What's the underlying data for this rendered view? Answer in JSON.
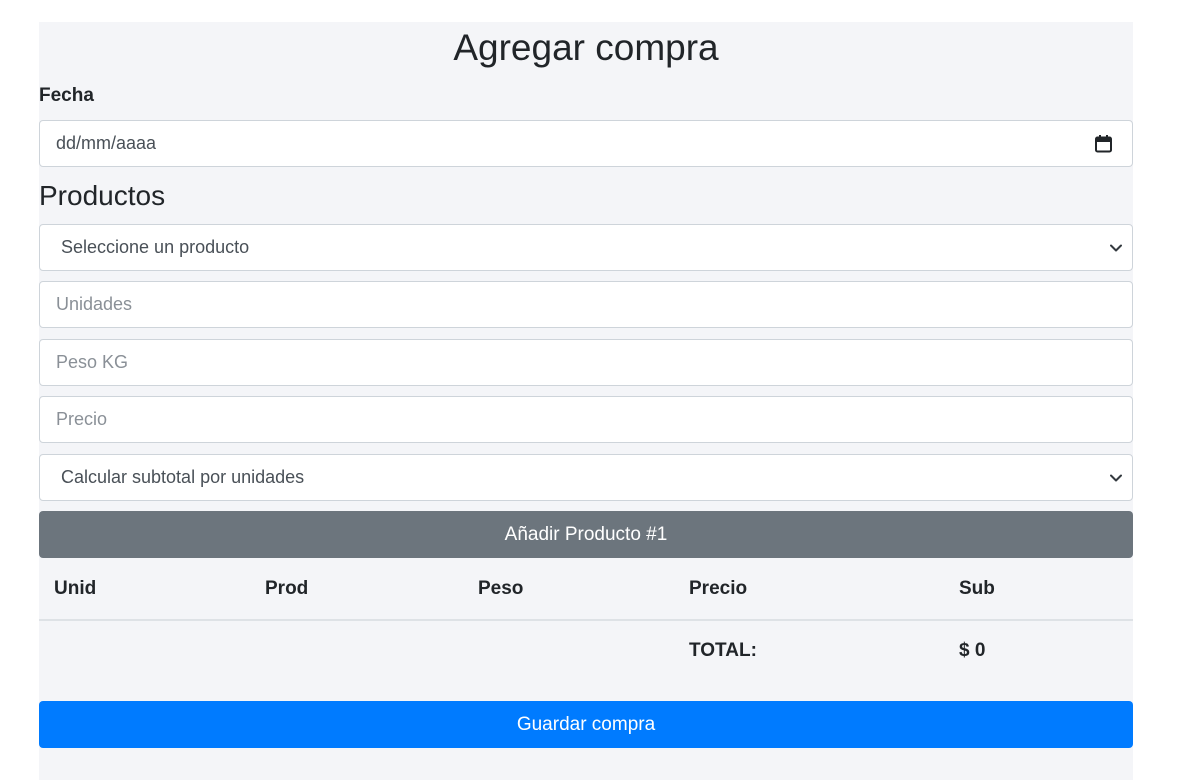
{
  "form": {
    "title": "Agregar compra",
    "date_label": "Fecha",
    "date_placeholder": "dd/mm/aaaa",
    "products_title": "Productos",
    "product_select": {
      "selected": "Seleccione un producto"
    },
    "units_placeholder": "Unidades",
    "weight_placeholder": "Peso KG",
    "price_placeholder": "Precio",
    "calc_select": {
      "selected": "Calcular subtotal por unidades"
    },
    "add_button_label": "Añadir Producto #1",
    "save_button_label": "Guardar compra"
  },
  "table": {
    "headers": [
      "Unid",
      "Prod",
      "Peso",
      "Precio",
      "Sub"
    ],
    "total_label": "TOTAL:",
    "total_value": "$ 0"
  },
  "colors": {
    "panel_bg": "#f4f5f8",
    "secondary_button": "#6c757d",
    "primary_button": "#007bff"
  },
  "icons": {
    "date": "calendar-icon",
    "select": "chevron-down-icon"
  }
}
